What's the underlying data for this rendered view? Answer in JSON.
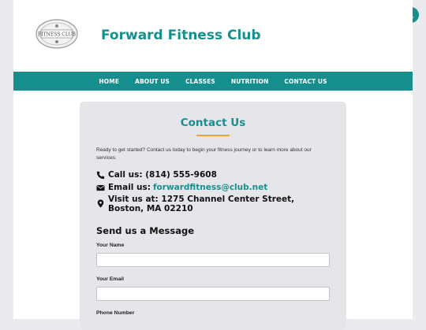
{
  "header": {
    "site_title": "Forward Fitness Club",
    "logo_text": "FITNESS CLUB"
  },
  "nav": {
    "items": [
      "HOME",
      "ABOUT US",
      "CLASSES",
      "NUTRITION",
      "CONTACT US"
    ]
  },
  "contact": {
    "title": "Contact Us",
    "intro": "Ready to get started? Contact us today to begin your fitness journey or to learn more about our services.",
    "call_label": "Call us: (814) 555-9608",
    "email_label": "Email us:",
    "email_value": "forwardfitness@club.net",
    "visit_label": "Visit us at: 1275 Channel Center Street, Boston, MA 02210"
  },
  "form": {
    "heading": "Send us a Message",
    "name_label": "Your Name",
    "email_label": "Your Email",
    "phone_label": "Phone Number",
    "name_value": "",
    "email_value": ""
  },
  "colors": {
    "accent": "#178f8f",
    "underline": "#f0a13a"
  },
  "icons": [
    "moon-icon",
    "phone-icon",
    "envelope-icon",
    "map-marker-icon"
  ]
}
